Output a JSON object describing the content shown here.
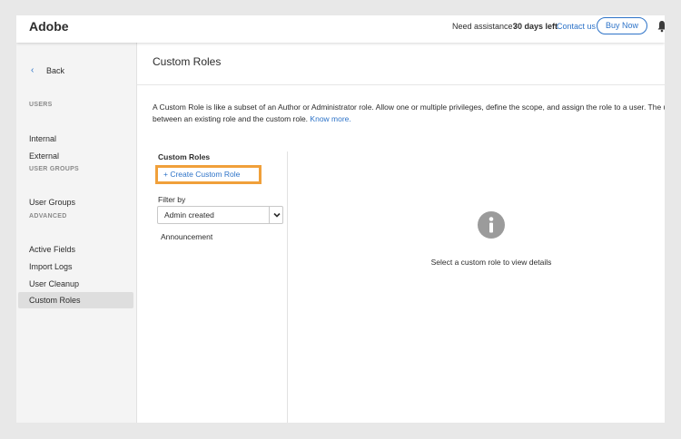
{
  "header": {
    "brand": "Adobe",
    "assistance_text": "Need assistance?",
    "trial_text": "30 days left",
    "contact_label": "Contact us",
    "buy_label": "Buy Now"
  },
  "sidebar": {
    "back_label": "Back",
    "sections": {
      "users": "USERS",
      "user_groups": "USER GROUPS",
      "advanced": "ADVANCED"
    },
    "items": [
      {
        "label": "Internal"
      },
      {
        "label": "External"
      },
      {
        "label": "User Groups"
      },
      {
        "label": "Active Fields"
      },
      {
        "label": "Import Logs"
      },
      {
        "label": "User Cleanup"
      },
      {
        "label": "Custom Roles",
        "active": true
      }
    ]
  },
  "main": {
    "title": "Custom Roles",
    "description_line1": "A Custom Role is like a subset of an Author or Administrator role. Allow one or multiple privileges, define the scope, and assign the role to a user. The user ca",
    "description_line2": "between an existing role and the custom role.",
    "know_more": "Know more."
  },
  "roles_panel": {
    "title": "Custom Roles",
    "create_label": "+ Create Custom Role",
    "filter_label": "Filter by",
    "filter_value": "Admin created",
    "items": [
      "Announcement"
    ]
  },
  "detail": {
    "empty_message": "Select a custom role to view details"
  },
  "colors": {
    "accent": "#2d73c8",
    "highlight": "#f0a03a",
    "sidebar_bg": "#f4f4f4",
    "page_bg": "#e8e8e8"
  },
  "icons": [
    "chevron-left-icon",
    "bell-icon",
    "chevron-down-icon",
    "info-icon"
  ]
}
